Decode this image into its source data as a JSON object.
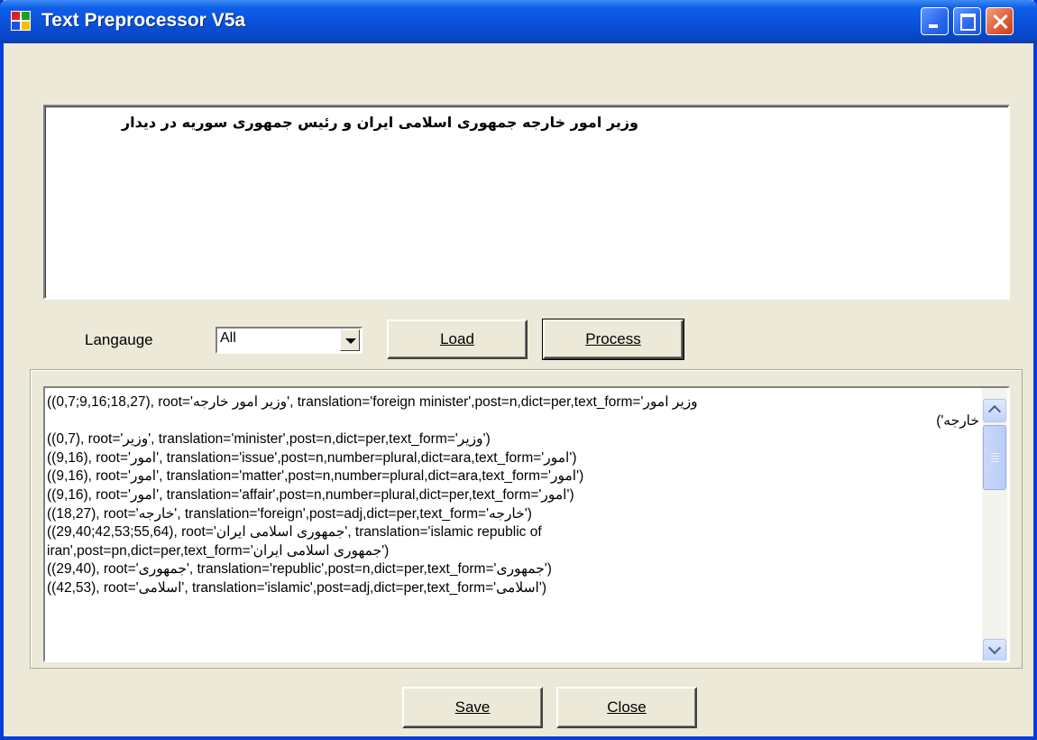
{
  "window": {
    "title": "Text Preprocessor V5a"
  },
  "input": {
    "text": "وزیر امور خارجه جمهوری اسلامی ایران و رئیس جمهوری سوریه در دیدار"
  },
  "language": {
    "label": "Langauge",
    "selected": "All"
  },
  "buttons": {
    "load": "Load",
    "process": "Process",
    "save": "Save",
    "close": "Close"
  },
  "output": {
    "lines": [
      "((0,7;9,16;18,27), root='وزیر امور خارجه', translation='foreign minister',post=n,dict=per,text_form='وزیر امور",
      "خارجه')",
      "((0,7), root='وزیر', translation='minister',post=n,dict=per,text_form='وزیر')",
      "((9,16), root='امور', translation='issue',post=n,number=plural,dict=ara,text_form='امور')",
      "((9,16), root='امور', translation='matter',post=n,number=plural,dict=ara,text_form='امور')",
      "((9,16), root='امور', translation='affair',post=n,number=plural,dict=per,text_form='امور')",
      "((18,27), root='خارجه', translation='foreign',post=adj,dict=per,text_form='خارجه')",
      "((29,40;42,53;55,64), root='جمهوری اسلامی ایران', translation='islamic republic of",
      "iran',post=pn,dict=per,text_form='جمهوری اسلامی ایران')",
      "((29,40), root='جمهوری', translation='republic',post=n,dict=per,text_form='جمهوری')",
      "((42,53), root='اسلامی', translation='islamic',post=adj,dict=per,text_form='اسلامی')"
    ]
  }
}
